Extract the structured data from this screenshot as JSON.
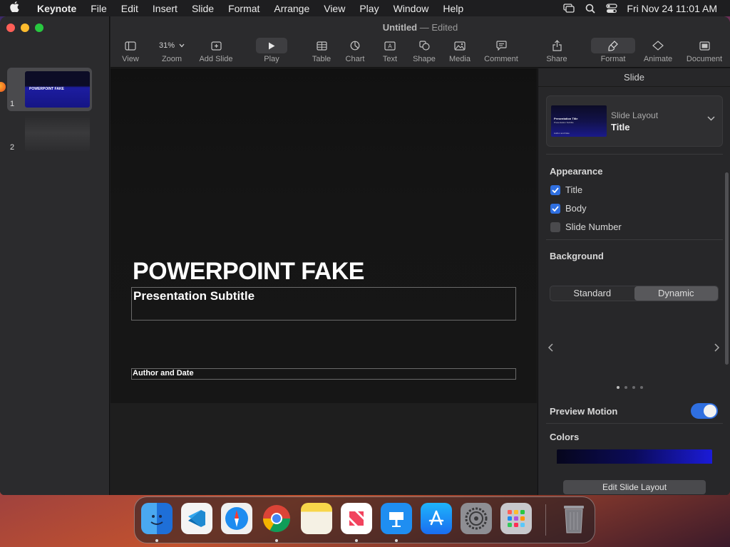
{
  "menubar": {
    "app_name": "Keynote",
    "items": [
      "File",
      "Edit",
      "Insert",
      "Slide",
      "Format",
      "Arrange",
      "View",
      "Play",
      "Window",
      "Help"
    ],
    "clock": "Fri Nov 24  11:01 AM"
  },
  "window": {
    "title": "Untitled",
    "title_sep": "—",
    "status": "Edited"
  },
  "toolbar": {
    "view": "View",
    "zoom_value": "31%",
    "zoom": "Zoom",
    "add_slide": "Add Slide",
    "play": "Play",
    "table": "Table",
    "chart": "Chart",
    "text": "Text",
    "shape": "Shape",
    "media": "Media",
    "comment": "Comment",
    "share": "Share",
    "format": "Format",
    "animate": "Animate",
    "document": "Document"
  },
  "navigator": {
    "slides": [
      {
        "number": "1",
        "thumb_title": "POWERPOINT FAKE"
      },
      {
        "number": "2",
        "thumb_title": ""
      }
    ]
  },
  "slide": {
    "title": "POWERPOINT FAKE",
    "subtitle": "Presentation Subtitle",
    "author": "Author and Date"
  },
  "inspector": {
    "header": "Slide",
    "layout_label": "Slide Layout",
    "layout_value": "Title",
    "layout_thumb_title": "Presentation Title",
    "layout_thumb_subtitle": "Presentation Subtitle",
    "layout_thumb_author": "Author and Date",
    "appearance_title": "Appearance",
    "checkboxes": [
      {
        "label": "Title",
        "checked": true
      },
      {
        "label": "Body",
        "checked": true
      },
      {
        "label": "Slide Number",
        "checked": false
      }
    ],
    "background_title": "Background",
    "background_options": [
      "Standard",
      "Dynamic"
    ],
    "background_selected": "Dynamic",
    "preview_motion": "Preview Motion",
    "preview_motion_on": true,
    "colors_title": "Colors",
    "edit_layout_button": "Edit Slide Layout"
  },
  "dock": {
    "apps": [
      "Finder",
      "Visual Studio Code",
      "Safari",
      "Google Chrome",
      "Notes",
      "News",
      "Keynote",
      "App Store",
      "System Settings",
      "Launchpad",
      "Trash"
    ]
  },
  "colors": {
    "accent": "#2f6fe0",
    "slide_background": "#111111",
    "inspector_background": "#272729"
  }
}
